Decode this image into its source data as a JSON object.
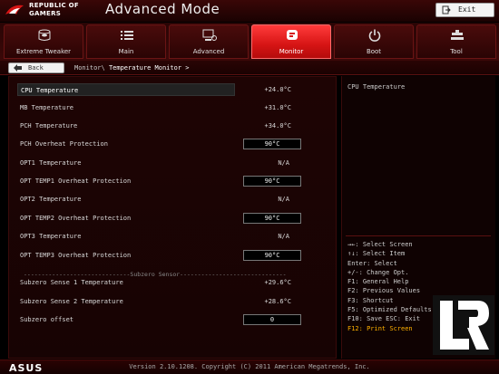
{
  "header": {
    "brand_line1": "REPUBLIC OF",
    "brand_line2": "GAMERS",
    "title": "Advanced Mode",
    "exit_label": "Exit"
  },
  "tabs": [
    {
      "label": "Extreme Tweaker",
      "icon": "tweaker-icon",
      "active": false
    },
    {
      "label": "Main",
      "icon": "list-icon",
      "active": false
    },
    {
      "label": "Advanced",
      "icon": "advanced-icon",
      "active": false
    },
    {
      "label": "Monitor",
      "icon": "monitor-icon",
      "active": true
    },
    {
      "label": "Boot",
      "icon": "power-icon",
      "active": false
    },
    {
      "label": "Tool",
      "icon": "tool-icon",
      "active": false
    }
  ],
  "breadcrumb": {
    "back_label": "Back",
    "path": "Monitor\\",
    "current": "Temperature Monitor >"
  },
  "rows": [
    {
      "label": "CPU Temperature",
      "value": "+24.0°C",
      "selected": true
    },
    {
      "label": "MB Temperature",
      "value": "+31.0°C"
    },
    {
      "label": "PCH Temperature",
      "value": "+34.0°C"
    },
    {
      "label": "PCH Overheat Protection",
      "field": "90°C"
    },
    {
      "label": "OPT1 Temperature",
      "value": "N/A"
    },
    {
      "label": "OPT TEMP1 Overheat Protection",
      "field": "90°C"
    },
    {
      "label": "OPT2 Temperature",
      "value": "N/A"
    },
    {
      "label": "OPT TEMP2 Overheat Protection",
      "field": "90°C"
    },
    {
      "label": "OPT3 Temperature",
      "value": "N/A"
    },
    {
      "label": "OPT TEMP3 Overheat Protection",
      "field": "90°C"
    },
    {
      "label": "Subzero Sense 1 Temperature",
      "value": "+29.6°C"
    },
    {
      "label": "Subzero Sense 2 Temperature",
      "value": "+28.6°C"
    },
    {
      "label": "Subzero offset",
      "field": "0"
    }
  ],
  "subzero_separator": "------------------------------Subzero Sensor------------------------------",
  "help": {
    "description": "CPU Temperature",
    "keys": [
      "→←: Select Screen",
      "↑↓: Select Item",
      "Enter: Select",
      "+/-: Change Opt.",
      "F1: General Help",
      "F2: Previous Values",
      "F3: Shortcut",
      "F5: Optimized Defaults",
      "F10: Save  ESC: Exit",
      "F12: Print Screen"
    ],
    "highlight_key_index": 9
  },
  "footer": {
    "brand": "ASUS",
    "version": "Version 2.10.1208. Copyright (C) 2011 American Megatrends, Inc."
  },
  "colors": {
    "accent": "#d61414",
    "highlight": "#ffb000",
    "background": "#170303"
  }
}
